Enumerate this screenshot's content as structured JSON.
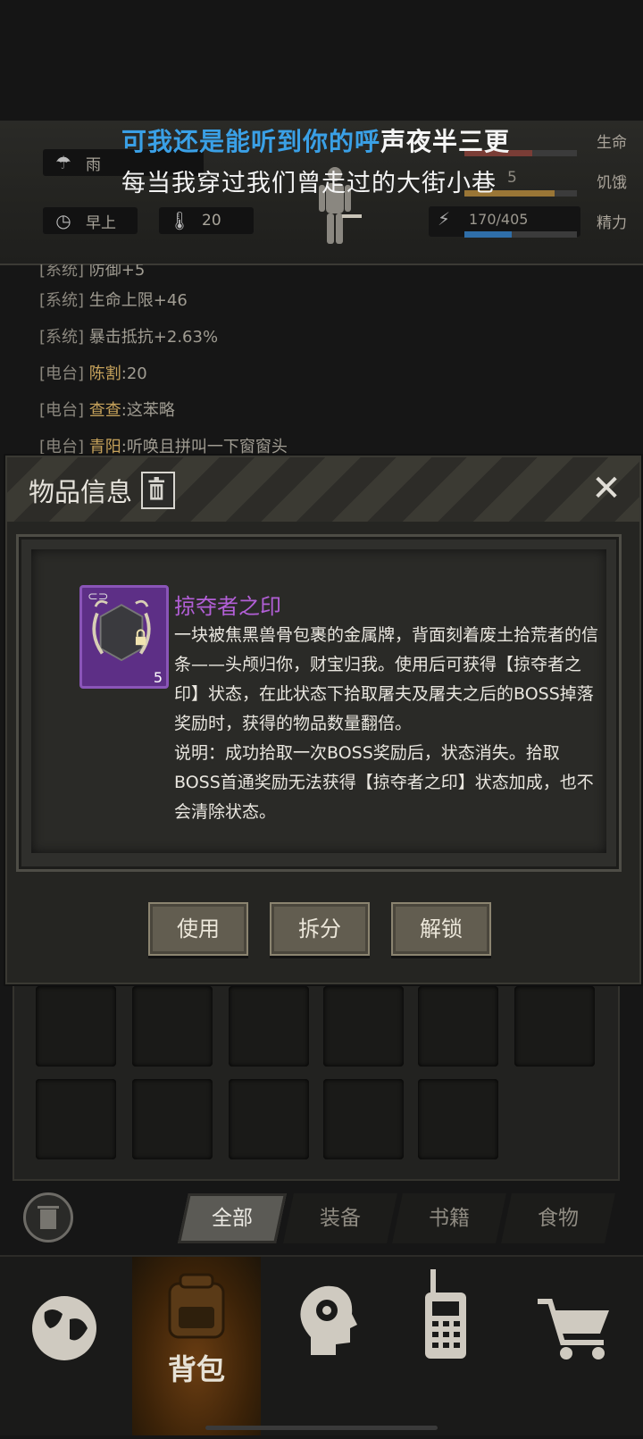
{
  "lyrics": {
    "line1_highlight": "可我还是能听到你的呼",
    "line1_rest": "声夜半三更",
    "line2": "每当我穿过我们曾走过的大街小巷"
  },
  "status": {
    "weather": "雨",
    "time_of_day": "早上",
    "temperature": "20",
    "energy_value": "170/405",
    "hunger_value_partial": "5",
    "life_label": "生命",
    "hunger_label": "饥饿",
    "energy_label": "精力",
    "life_fill": 0.6,
    "hunger_fill": 0.8,
    "energy_fill": 0.42,
    "colors": {
      "life": "#7a3d36",
      "hunger": "#9a7636",
      "energy": "#2f6ea8"
    }
  },
  "log": [
    {
      "tag": "[系统]",
      "who": "",
      "msg": "防御+5"
    },
    {
      "tag": "[系统]",
      "who": "",
      "msg": "生命上限+46"
    },
    {
      "tag": "[系统]",
      "who": "",
      "msg": "暴击抵抗+2.63%"
    },
    {
      "tag": "[电台]",
      "who": "陈割",
      "msg": ":20"
    },
    {
      "tag": "[电台]",
      "who": "查查",
      "msg": ":这苯略"
    },
    {
      "tag": "[电台]",
      "who": "青阳",
      "msg": ":听唤且拼叫一下窗窗头"
    }
  ],
  "dialog": {
    "title": "物品信息",
    "close": "✕",
    "item": {
      "name": "掠夺者之印",
      "count": "5",
      "rarity_color": "#5d2f86",
      "description": "一块被焦黑兽骨包裹的金属牌，背面刻着废土拾荒者的信条——头颅归你，财宝归我。使用后可获得【掠夺者之印】状态，在此状态下拾取屠夫及屠夫之后的BOSS掉落奖励时，获得的物品数量翻倍。",
      "note": "说明：成功拾取一次BOSS奖励后，状态消失。拾取BOSS首通奖励无法获得【掠夺者之印】状态加成，也不会清除状态。"
    },
    "buttons": {
      "use": "使用",
      "split": "拆分",
      "unlock": "解锁"
    }
  },
  "tabs": {
    "all": "全部",
    "equip": "装备",
    "books": "书籍",
    "food": "食物"
  },
  "nav": {
    "map_icon": "globe-icon",
    "backpack": "背包",
    "skills_icon": "head-gear-icon",
    "radio_icon": "walkie-talkie-icon",
    "shop_icon": "cart-icon"
  }
}
